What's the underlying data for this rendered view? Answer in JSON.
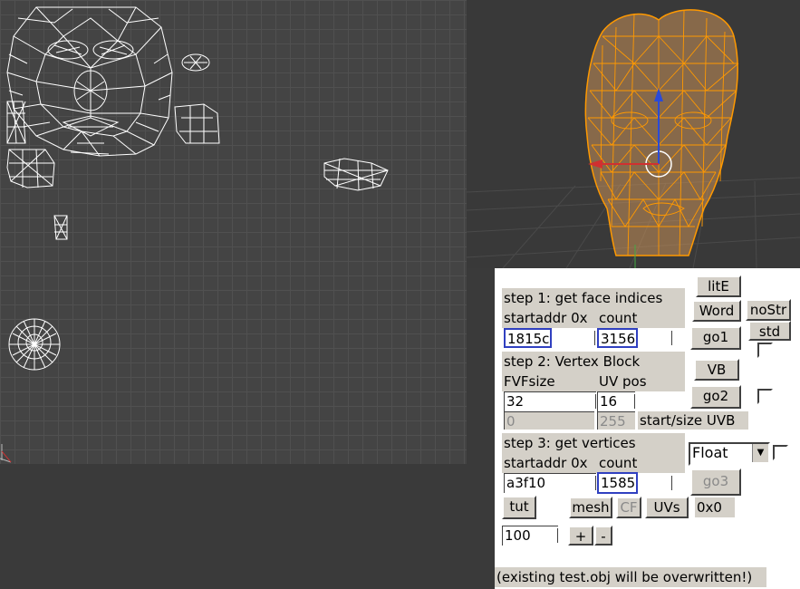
{
  "step1": {
    "title": "step 1: get face indices",
    "col1": "startaddr 0x",
    "col2": "count",
    "startaddr": "1815c",
    "count": "3156"
  },
  "step2": {
    "title": "step 2: Vertex Block",
    "col1": "FVFsize",
    "col2": "UV pos",
    "fvfsize": "32",
    "uvpos": "16",
    "uvb_start": "0",
    "uvb_size": "255",
    "uvb_label": "start/size UVB"
  },
  "step3": {
    "title": "step 3: get vertices",
    "col1": "startaddr 0x",
    "col2": "count",
    "startaddr": "a3f10",
    "count": "1585",
    "type": "Float"
  },
  "buttons": {
    "lite": "litE",
    "word": "Word",
    "nostr": "noStr",
    "std": "std",
    "go1": "go1",
    "vb": "VB",
    "go2": "go2",
    "go3": "go3",
    "tut": "tut",
    "mesh": "mesh",
    "cf": "CF",
    "uvs": "UVs",
    "plus": "+",
    "minus": "-"
  },
  "readout": "0x0",
  "scale_value": "100",
  "note": "(existing test.obj will be overwritten!)",
  "colors": {
    "panel": "#d4d0c8",
    "highlight": "#3040c0",
    "mesh": "#ff9900"
  }
}
